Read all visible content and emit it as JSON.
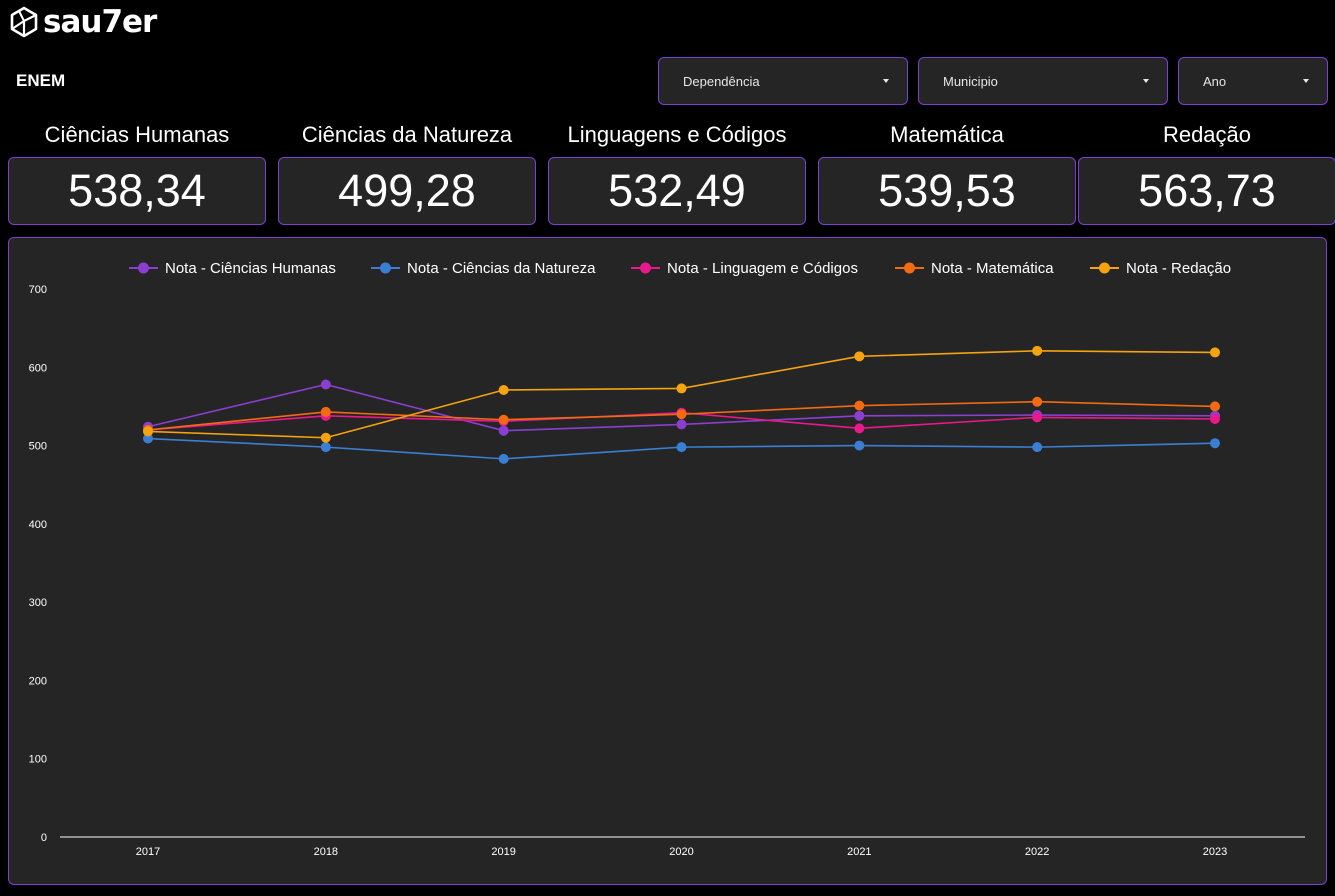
{
  "brand": {
    "name": "sau7er"
  },
  "page": {
    "title": "ENEM"
  },
  "filters": [
    {
      "label": "Dependência",
      "icon": "chevron-down-icon"
    },
    {
      "label": "Municipio",
      "icon": "chevron-down-icon"
    },
    {
      "label": "Ano",
      "icon": "chevron-down-icon"
    }
  ],
  "kpis": [
    {
      "title": "Ciências Humanas",
      "value": "538,34"
    },
    {
      "title": "Ciências da Natureza",
      "value": "499,28"
    },
    {
      "title": "Linguagens e Códigos",
      "value": "532,49"
    },
    {
      "title": "Matemática",
      "value": "539,53"
    },
    {
      "title": "Redação",
      "value": "563,73"
    }
  ],
  "colors": {
    "background": "#000000",
    "panel": "#252525",
    "border": "#7b3fd4",
    "axis": "#ffffff"
  },
  "chart_data": {
    "type": "line",
    "x": [
      "2017",
      "2018",
      "2019",
      "2020",
      "2021",
      "2022",
      "2023"
    ],
    "ylim": [
      0,
      700
    ],
    "yticks": [
      0,
      100,
      200,
      300,
      400,
      500,
      600,
      700
    ],
    "grid": false,
    "legend_position": "top",
    "series": [
      {
        "name": "Nota - Ciências Humanas",
        "color": "#8a3fd1",
        "values": [
          524,
          578,
          519,
          527,
          538,
          539,
          538
        ]
      },
      {
        "name": "Nota - Ciências da Natureza",
        "color": "#3b7fd4",
        "values": [
          509,
          498,
          483,
          498,
          500,
          498,
          503
        ]
      },
      {
        "name": "Nota - Linguagem e Códigos",
        "color": "#e8198b",
        "values": [
          520,
          538,
          531,
          542,
          522,
          536,
          534
        ]
      },
      {
        "name": "Nota - Matemática",
        "color": "#f26b12",
        "values": [
          520,
          543,
          533,
          540,
          551,
          556,
          550
        ]
      },
      {
        "name": "Nota - Redação",
        "color": "#f5a30f",
        "values": [
          518,
          510,
          571,
          573,
          614,
          621,
          619
        ]
      }
    ]
  }
}
